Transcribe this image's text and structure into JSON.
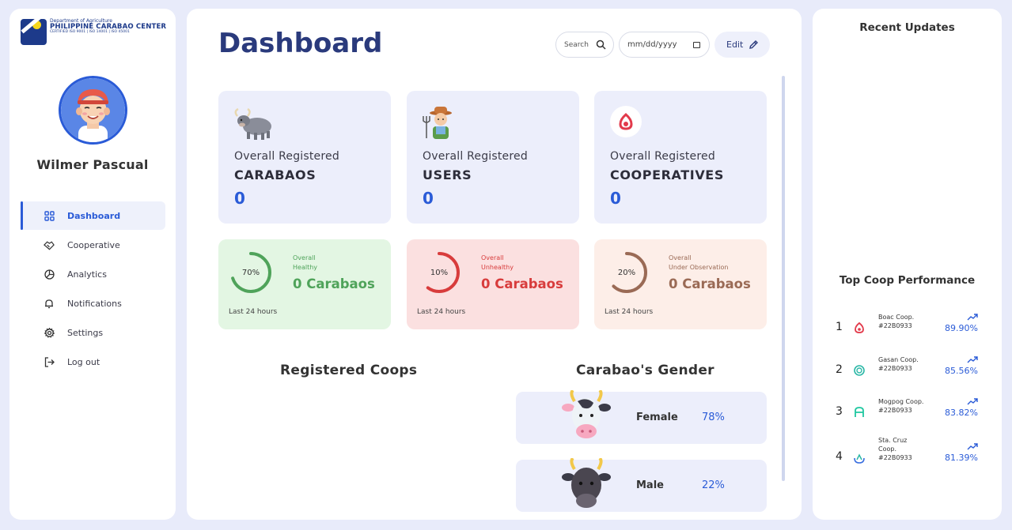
{
  "logo": {
    "line1": "Department of Agriculture",
    "line2": "PHILIPPINE CARABAO CENTER",
    "line3": "CERTIFIED ISO 9001 | ISO 14001 | ISO 45001"
  },
  "user": {
    "name": "Wilmer Pascual"
  },
  "nav": [
    {
      "label": "Dashboard",
      "icon": "grid-icon",
      "active": true
    },
    {
      "label": "Cooperative",
      "icon": "handshake-icon"
    },
    {
      "label": "Analytics",
      "icon": "pie-chart-icon"
    },
    {
      "label": "Notifications",
      "icon": "bell-icon"
    },
    {
      "label": "Settings",
      "icon": "gear-icon"
    },
    {
      "label": "Log out",
      "icon": "logout-icon"
    }
  ],
  "header": {
    "title": "Dashboard",
    "search_label": "Search",
    "date_placeholder": "mm/dd/yyyy",
    "edit_label": "Edit"
  },
  "cards": [
    {
      "line1": "Overall Registered",
      "line2": "CARABAOS",
      "value": "0",
      "icon": "carabao-icon"
    },
    {
      "line1": "Overall Registered",
      "line2": "USERS",
      "value": "0",
      "icon": "farmer-icon"
    },
    {
      "line1": "Overall Registered",
      "line2": "COOPERATIVES",
      "value": "0",
      "icon": "cooperative-icon"
    }
  ],
  "stats": [
    {
      "percent": "70%",
      "fraction": 0.7,
      "label1": "Overall",
      "label2": "Healthy",
      "value": "0 Carabaos",
      "period": "Last 24 hours",
      "color": "#4fa35a",
      "bg": "#e3f6e3"
    },
    {
      "percent": "10%",
      "fraction": 0.6,
      "label1": "Overall",
      "label2": "Unhealthy",
      "value": "0 Carabaos",
      "period": "Last 24 hours",
      "color": "#d83c3c",
      "bg": "#fbe0e0"
    },
    {
      "percent": "20%",
      "fraction": 0.62,
      "label1": "Overall",
      "label2": "Under Observation",
      "value": "0 Carabaos",
      "period": "Last 24 hours",
      "color": "#9a6a55",
      "bg": "#fdeee8"
    }
  ],
  "sections": {
    "registered_coops": "Registered Coops",
    "carabao_gender": "Carabao's Gender"
  },
  "gender": [
    {
      "label": "Female",
      "percent": "78%",
      "icon": "female-carabao-icon"
    },
    {
      "label": "Male",
      "percent": "22%",
      "icon": "male-carabao-icon"
    }
  ],
  "right": {
    "recent_updates": "Recent Updates",
    "top_coop": "Top Coop Performance",
    "coops": [
      {
        "rank": "1",
        "name": "Boac Coop.",
        "id": "#22B0933",
        "rate": "89.90%",
        "color": "#e23a4b"
      },
      {
        "rank": "2",
        "name": "Gasan Coop.",
        "id": "#22B0933",
        "rate": "85.56%",
        "color": "#2ab7a6"
      },
      {
        "rank": "3",
        "name": "Mogpog Coop.",
        "id": "#22B0933",
        "rate": "83.82%",
        "color": "#1fc7a0"
      },
      {
        "rank": "4",
        "name": "Sta. Cruz Coop.",
        "id": "#22B0933",
        "rate": "81.39%",
        "color": "#3a6fe0"
      }
    ]
  }
}
